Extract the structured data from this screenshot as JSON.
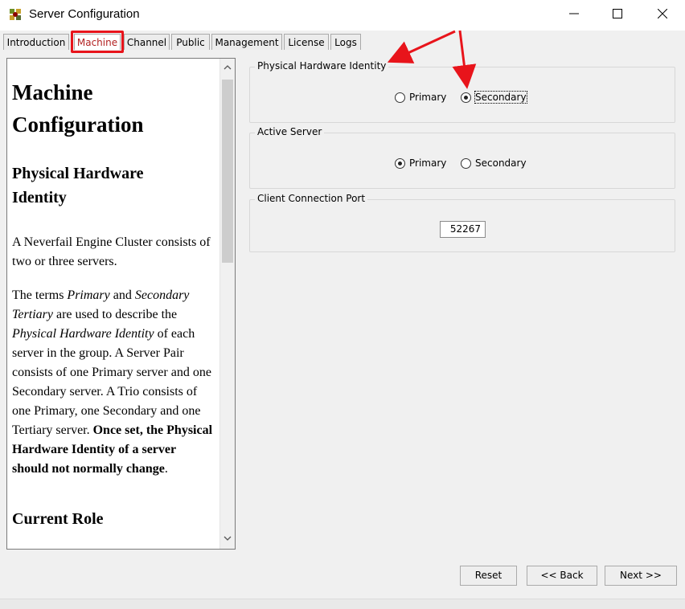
{
  "window": {
    "title": "Server Configuration",
    "icon": "server-app-icon",
    "controls": {
      "minimize": "—",
      "maximize": "☐",
      "close": "✕"
    }
  },
  "tabs": [
    {
      "label": "Introduction",
      "active": false
    },
    {
      "label": "Machine",
      "active": true
    },
    {
      "label": "Channel",
      "active": false
    },
    {
      "label": "Public",
      "active": false
    },
    {
      "label": "Management",
      "active": false
    },
    {
      "label": "License",
      "active": false
    },
    {
      "label": "Logs",
      "active": false
    }
  ],
  "help": {
    "heading1_line1": "Machine",
    "heading1_line2": "Configuration",
    "heading2_line1": "Physical Hardware",
    "heading2_line2": "Identity",
    "para1": "A Neverfail Engine Cluster consists of two or three servers.",
    "para2_parts": {
      "a": "The terms ",
      "primary": "Primary",
      "and": " and ",
      "secondary_tertiary": "Secondary Tertiary",
      "are": " are used to describe the ",
      "phi": "Physical Hardware Identity",
      "rest": " of each server in the group. A Server Pair consists of one Primary server and one Secondary server. A Trio consists of one Primary, one Secondary and one Tertiary server. ",
      "bold": "Once set, the Physical Hardware Identity of a server should not normally change",
      "end": "."
    },
    "heading3": "Current Role"
  },
  "groups": {
    "physical": {
      "title": "Physical Hardware Identity",
      "primary_label": "Primary",
      "secondary_label": "Secondary",
      "selected": "Secondary"
    },
    "active": {
      "title": "Active Server",
      "primary_label": "Primary",
      "secondary_label": "Secondary",
      "selected": "Primary"
    },
    "port": {
      "title": "Client Connection Port",
      "value": "52267"
    }
  },
  "buttons": {
    "reset": "Reset",
    "back": "<< Back",
    "next": "Next >>"
  },
  "colors": {
    "annotation_red": "#e8141b",
    "active_tab_text": "#b22222"
  }
}
